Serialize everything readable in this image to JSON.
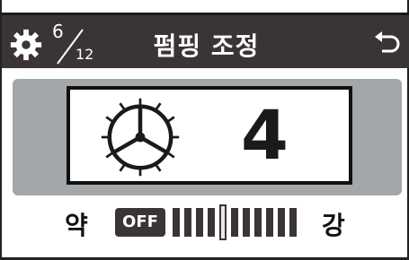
{
  "header": {
    "page_current": "6",
    "page_total": "12",
    "title": "펌핑 조정",
    "settings_icon": "gear-icon",
    "back_icon": "back-arrow-icon",
    "background_color": "#3b3436"
  },
  "display": {
    "icon": "pump-wheel-icon",
    "level_value": "4"
  },
  "slider": {
    "weak_label": "약",
    "strong_label": "강",
    "off_label": "OFF",
    "tick_count": 11,
    "selected_tick": 4
  }
}
